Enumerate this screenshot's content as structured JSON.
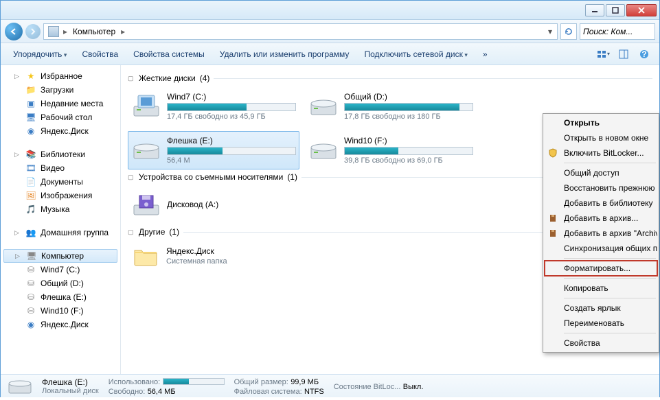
{
  "breadcrumb": {
    "root": "Компьютер"
  },
  "search": {
    "placeholder": "Поиск: Ком..."
  },
  "toolbar": {
    "organize": "Упорядочить",
    "properties": "Свойства",
    "sysprops": "Свойства системы",
    "uninstall": "Удалить или изменить программу",
    "netdrive": "Подключить сетевой диск",
    "more": "»"
  },
  "sidebar": {
    "favorites": {
      "title": "Избранное",
      "items": [
        {
          "label": "Загрузки"
        },
        {
          "label": "Недавние места"
        },
        {
          "label": "Рабочий стол"
        },
        {
          "label": "Яндекс.Диск"
        }
      ]
    },
    "libraries": {
      "title": "Библиотеки",
      "items": [
        {
          "label": "Видео"
        },
        {
          "label": "Документы"
        },
        {
          "label": "Изображения"
        },
        {
          "label": "Музыка"
        }
      ]
    },
    "homegroup": {
      "title": "Домашняя группа"
    },
    "computer": {
      "title": "Компьютер",
      "items": [
        {
          "label": "Wind7 (C:)"
        },
        {
          "label": "Общий (D:)"
        },
        {
          "label": "Флешка (E:)"
        },
        {
          "label": "Wind10 (F:)"
        },
        {
          "label": "Яндекс.Диск"
        }
      ]
    }
  },
  "groups": {
    "hdd": {
      "title": "Жесткие диски",
      "count": "(4)"
    },
    "removable": {
      "title": "Устройства со съемными носителями",
      "count": "(1)"
    },
    "other": {
      "title": "Другие",
      "count": "(1)"
    }
  },
  "drives": {
    "c": {
      "name": "Wind7 (C:)",
      "free": "17,4 ГБ свободно из 45,9 ГБ",
      "pct": 62
    },
    "d": {
      "name": "Общий (D:)",
      "free": "17,8 ГБ свободно из 180 ГБ",
      "pct": 90
    },
    "e": {
      "name": "Флешка (E:)",
      "free": "56,4 М",
      "pct": 43
    },
    "f": {
      "name": "Wind10 (F:)",
      "free": "39,8 ГБ свободно из 69,0 ГБ",
      "pct": 42
    },
    "dvd": {
      "name": "Дисковод (A:)"
    },
    "yadisk": {
      "name": "Яндекс.Диск",
      "sub": "Системная папка"
    }
  },
  "context": {
    "open": "Открыть",
    "newwin": "Открыть в новом окне",
    "bitlocker": "Включить BitLocker...",
    "share": "Общий доступ",
    "restore": "Восстановить прежнюю",
    "addlib": "Добавить в библиотеку",
    "addarch": "Добавить в архив...",
    "addarch2": "Добавить в архив \"Archiv",
    "sync": "Синхронизация общих п",
    "format": "Форматировать...",
    "copy": "Копировать",
    "shortcut": "Создать ярлык",
    "rename": "Переименовать",
    "props": "Свойства"
  },
  "status": {
    "name": "Флешка (E:)",
    "type": "Локальный диск",
    "used_l": "Использовано:",
    "used_v": "",
    "free_l": "Свободно:",
    "free_v": "56,4 МБ",
    "size_l": "Общий размер:",
    "size_v": "99,9 МБ",
    "fs_l": "Файловая система:",
    "fs_v": "NTFS",
    "bl_l": "Состояние BitLoc...",
    "bl_v": "Выкл."
  }
}
